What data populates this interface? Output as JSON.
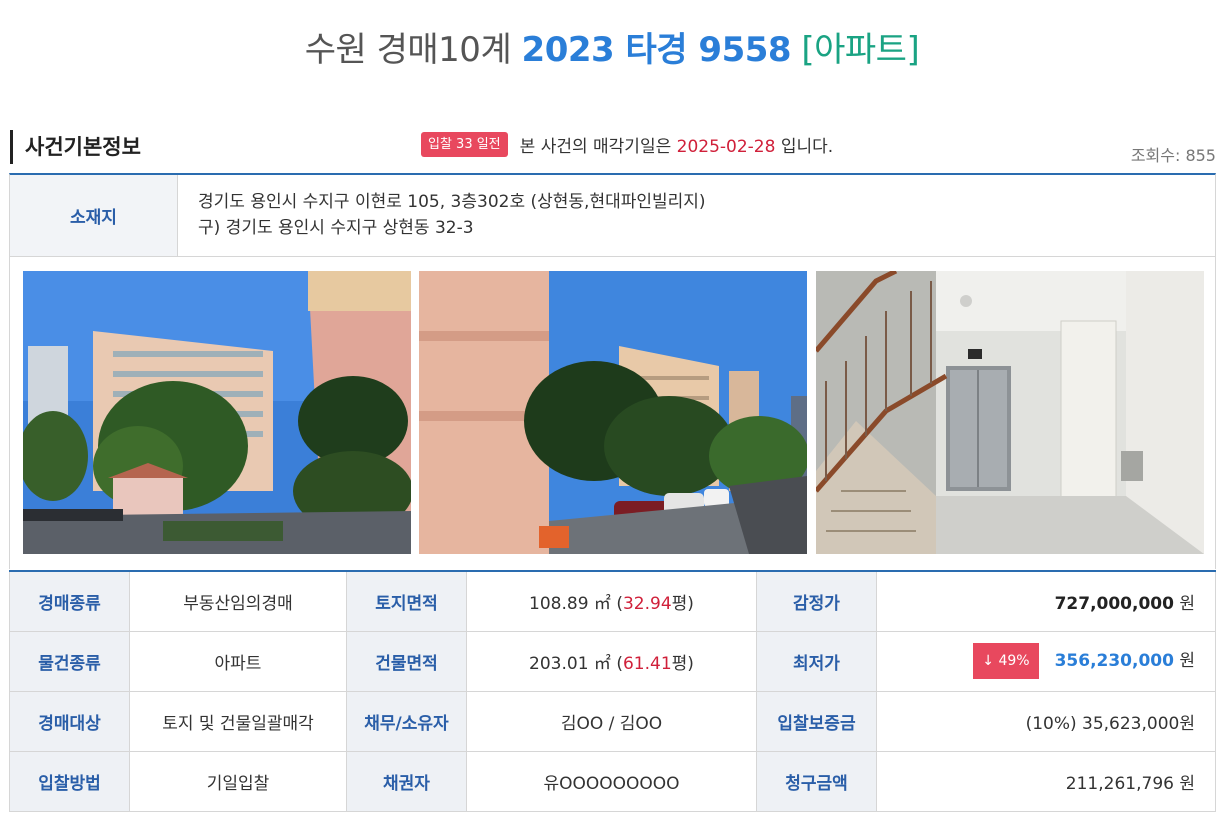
{
  "title": {
    "court": "수원 경매10계",
    "case_no": "2023 타경 9558",
    "property_type": "[아파트]"
  },
  "section": {
    "label": "사건기본정보",
    "notice_badge": "입찰 33 일전",
    "notice_prefix": "본 사건의 매각기일은",
    "sale_date": "2025-02-28",
    "notice_suffix": "입니다.",
    "views": "조회수: 855"
  },
  "location": {
    "label": "소재지",
    "road_address": "경기도 용인시 수지구 이현로 105, 3층302호 (상현동,현대파인빌리지)",
    "old_address": "구) 경기도 용인시 수지구 상현동 32-3"
  },
  "photos": [
    "building-exterior-photo",
    "building-exterior-photo",
    "stairwell-elevator-photo"
  ],
  "rows": [
    {
      "h1": "경매종류",
      "v1": "부동산임의경매",
      "h2": "토지면적",
      "v2_num": "108.89 ㎡ (",
      "v2_red": "32.94",
      "v2_tail": "평)",
      "h3": "감정가",
      "v3_num": "727,000,000",
      "v3_unit": " 원"
    },
    {
      "h1": "물건종류",
      "v1": "아파트",
      "h2": "건물면적",
      "v2_num": "203.01 ㎡ (",
      "v2_red": "61.41",
      "v2_tail": "평)",
      "h3": "최저가",
      "v3_badge": "↓ 49%",
      "v3_num": "356,230,000",
      "v3_unit": " 원"
    },
    {
      "h1": "경매대상",
      "v1": "토지 및 건물일괄매각",
      "h2": "채무/소유자",
      "v2": "김OO / 김OO",
      "h3": "입찰보증금",
      "v3": "(10%) 35,623,000원"
    },
    {
      "h1": "입찰방법",
      "v1": "기일입찰",
      "h2": "채권자",
      "v2": "유OOOOOOOOO",
      "h3": "청구금액",
      "v3": "211,261,796 원"
    }
  ],
  "colors": {
    "accent_blue": "#2a7ed8",
    "accent_green": "#1aa383",
    "alert_red": "#e8485e"
  }
}
